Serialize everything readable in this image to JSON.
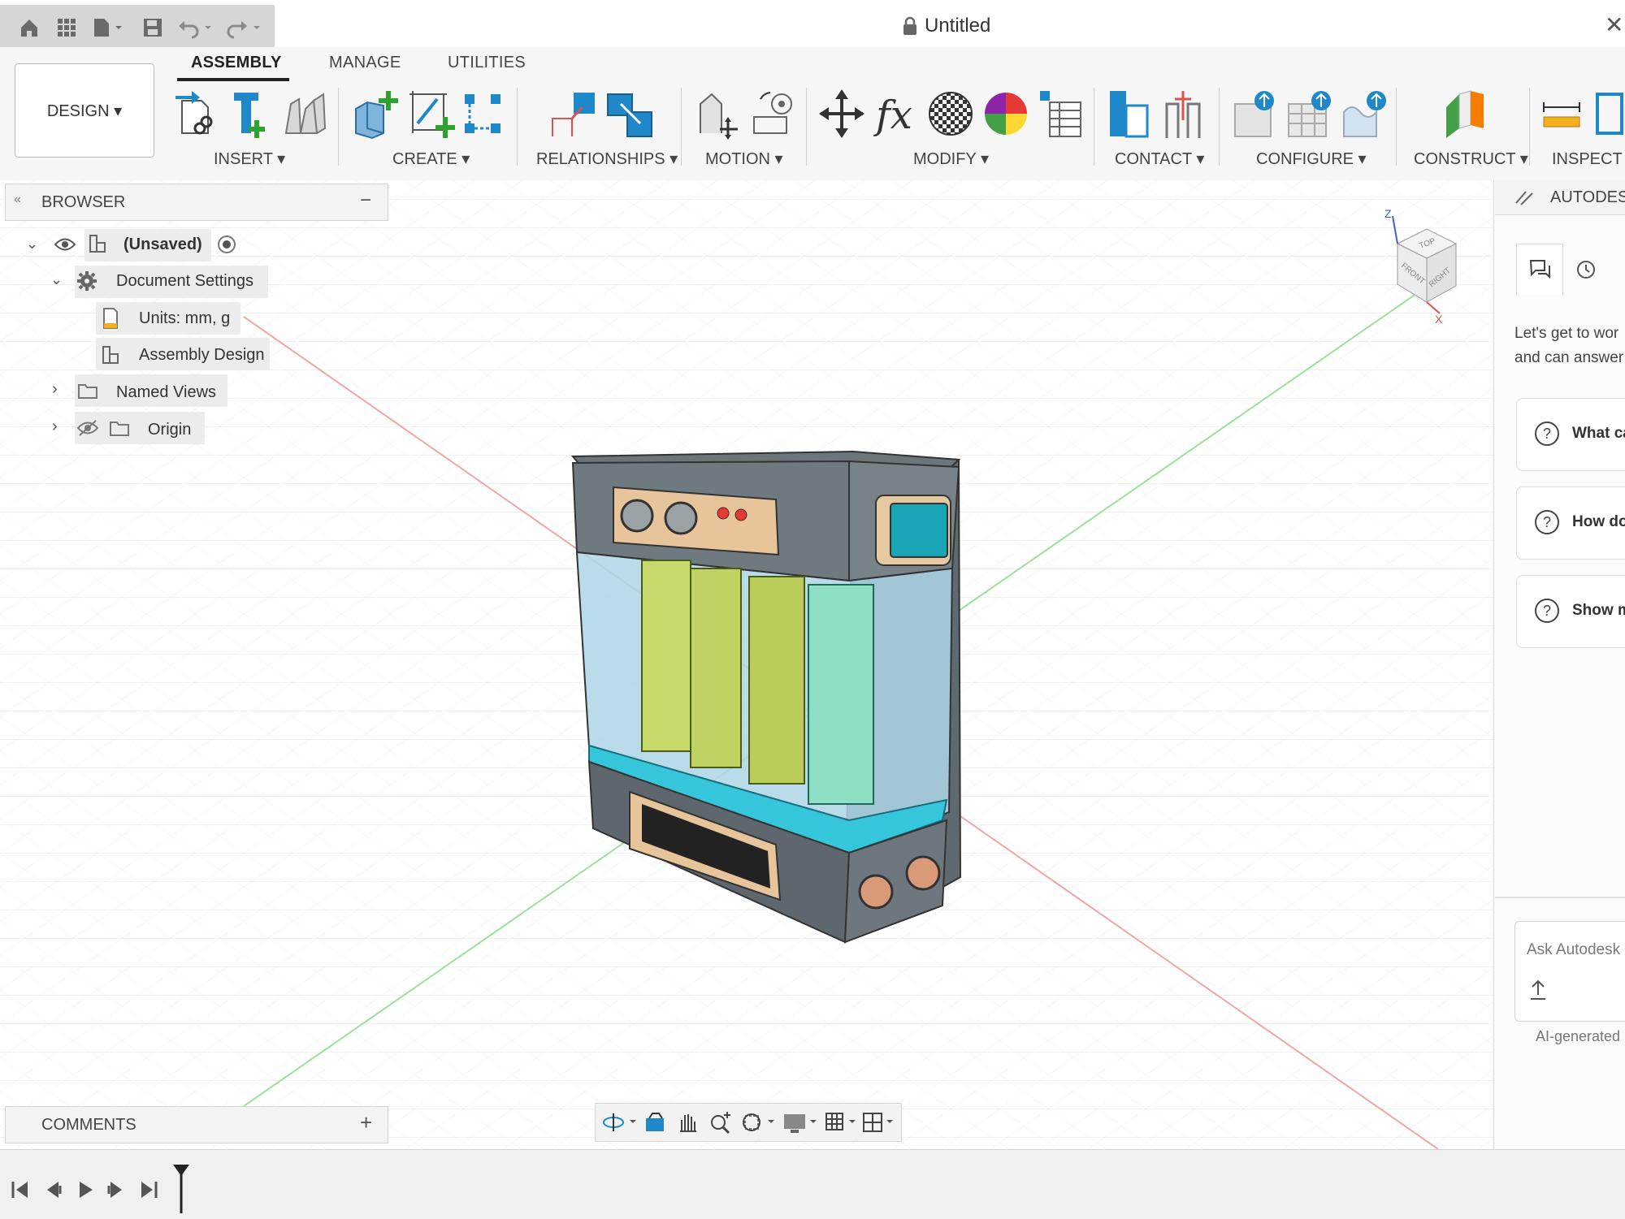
{
  "window": {
    "title": "Untitled"
  },
  "tabs": [
    "ASSEMBLY",
    "MANAGE",
    "UTILITIES"
  ],
  "workspace": {
    "label": "DESIGN ▾"
  },
  "toolbar_groups": [
    "INSERT ▾",
    "CREATE ▾",
    "RELATIONSHIPS ▾",
    "MOTION ▾",
    "MODIFY ▾",
    "CONTACT ▾",
    "CONFIGURE ▾",
    "CONSTRUCT ▾",
    "INSPECT ▾"
  ],
  "browser": {
    "title": "BROWSER",
    "items": [
      {
        "label": "(Unsaved)"
      },
      {
        "label": "Document Settings"
      },
      {
        "label": "Units: mm, g"
      },
      {
        "label": "Assembly Design"
      },
      {
        "label": "Named Views"
      },
      {
        "label": "Origin"
      }
    ]
  },
  "viewcube": {
    "faces": [
      "TOP",
      "FRONT",
      "RIGHT"
    ],
    "axes": [
      "Z",
      "X"
    ]
  },
  "assistant": {
    "title": "AUTODESK",
    "intro_line1": "Let's get to wor",
    "intro_line2": "and can answer",
    "suggestions": [
      "What ca",
      "How do",
      "Show m"
    ],
    "input_placeholder": "Ask Autodesk",
    "footer": "AI-generated"
  },
  "comments": {
    "label": "COMMENTS"
  },
  "colors": {
    "accent_blue": "#1e88c9",
    "ribbon_bg": "#f6f6f6",
    "panel_bg": "#f3f3f3"
  }
}
